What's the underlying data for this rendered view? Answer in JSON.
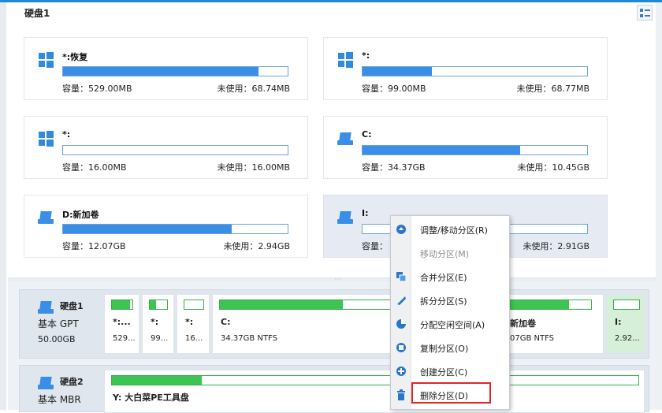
{
  "disk1_section": {
    "title": "硬盘1"
  },
  "partition_cards": [
    {
      "name": "*:恢复",
      "capacity": "容量：529.00MB",
      "unused": "未使用：68.74MB",
      "used_fraction": 0.87,
      "icon": "windows-icon"
    },
    {
      "name": "*:",
      "capacity": "容量：99.00MB",
      "unused": "未使用：68.77MB",
      "used_fraction": 0.31,
      "icon": "windows-icon"
    },
    {
      "name": "*:",
      "capacity": "容量：16.00MB",
      "unused": "未使用：16.00MB",
      "used_fraction": 0.0,
      "icon": "windows-icon"
    },
    {
      "name": "C:",
      "capacity": "容量：34.37GB",
      "unused": "未使用：10.45GB",
      "used_fraction": 0.7,
      "icon": "drive-icon"
    },
    {
      "name": "D:新加卷",
      "capacity": "容量：12.07GB",
      "unused": "未使用：2.94GB",
      "used_fraction": 0.75,
      "icon": "drive-icon"
    },
    {
      "name": "I:",
      "capacity": "容量：",
      "unused": "未使用：2.91GB",
      "used_fraction": 0.0,
      "icon": "drive-icon",
      "selected": true
    }
  ],
  "disks": [
    {
      "name": "硬盘1",
      "type": "基本 GPT",
      "size": "50.00GB",
      "partitions": [
        {
          "name": "*:...",
          "info": "529...",
          "fill": 0.88
        },
        {
          "name": "*:",
          "info": "99...",
          "fill": 0.35
        },
        {
          "name": "*:",
          "info": "16...",
          "fill": 0.0
        },
        {
          "name": "C:",
          "info": "34.37GB NTFS",
          "fill": 0.7
        },
        {
          "name": "新加卷",
          "info": "07GB NTFS",
          "fill": 0.75
        },
        {
          "name": "I:",
          "info": "2.92...",
          "fill": 0.0,
          "selected": true
        }
      ]
    },
    {
      "name": "硬盘2",
      "type": "基本 MBR",
      "partitions": [
        {
          "name": "Y: 大白菜PE工具盘",
          "fill": 0.17
        }
      ]
    }
  ],
  "context_menu": {
    "items": [
      {
        "label": "调整/移动分区(R)",
        "icon": "resize-icon",
        "enabled": true
      },
      {
        "label": "移动分区(M)",
        "icon": "",
        "enabled": false
      },
      {
        "label": "合并分区(E)",
        "icon": "merge-icon",
        "enabled": true
      },
      {
        "label": "拆分分区(S)",
        "icon": "split-icon",
        "enabled": true
      },
      {
        "label": "分配空闲空间(A)",
        "icon": "allocate-icon",
        "enabled": true
      },
      {
        "label": "复制分区(O)",
        "icon": "copy-icon",
        "enabled": true
      },
      {
        "label": "创建分区(C)",
        "icon": "create-icon",
        "enabled": true
      },
      {
        "label": "删除分区(D)",
        "icon": "trash-icon",
        "enabled": true,
        "highlighted": true
      }
    ]
  },
  "colors": {
    "accent": "#3a8ee6",
    "partition_green": "#3dc453",
    "highlight_red": "#e0262c"
  }
}
